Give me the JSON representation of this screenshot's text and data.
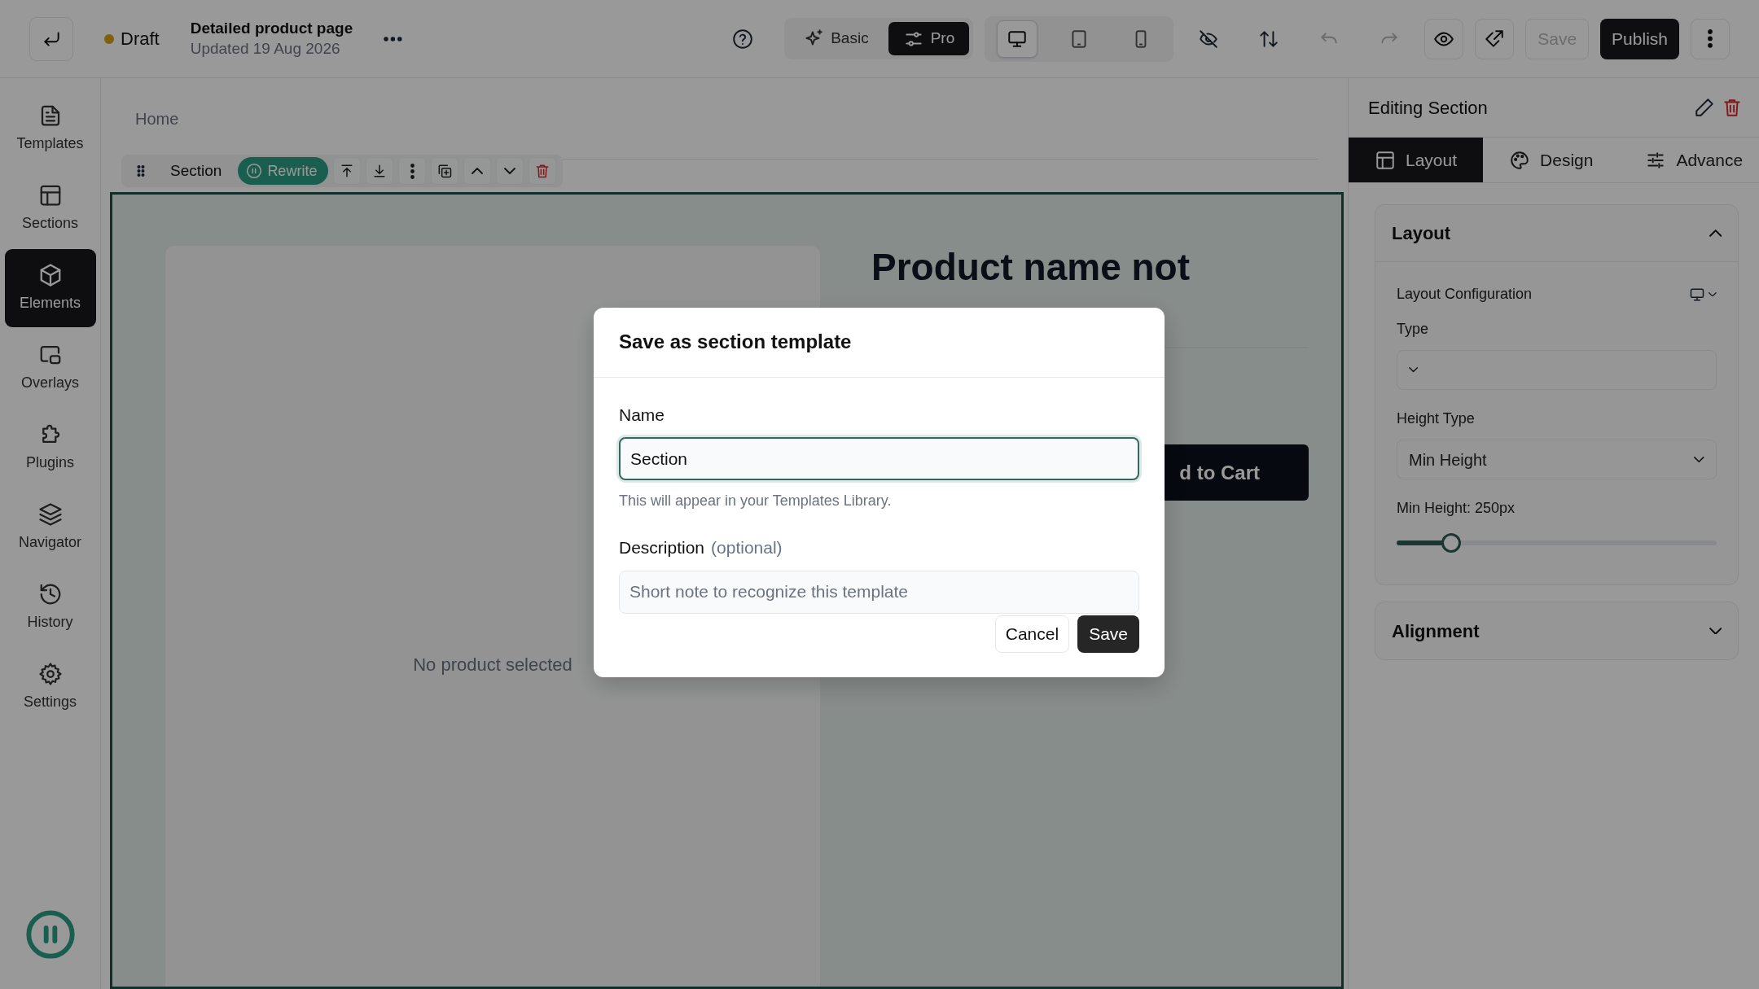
{
  "topbar": {
    "status": "Draft",
    "title": "Detailed product page",
    "updated": "Updated 19 Aug 2026",
    "modes": [
      {
        "kind": "basic",
        "label": "Basic",
        "selected": false
      },
      {
        "kind": "pro",
        "label": "Pro",
        "selected": true
      }
    ],
    "devices": [
      {
        "kind": "desktop",
        "selected": true
      },
      {
        "kind": "tablet",
        "selected": false
      },
      {
        "kind": "mobile",
        "selected": false
      }
    ],
    "history": [
      {
        "kind": "undo",
        "disabled": true
      },
      {
        "kind": "redo",
        "disabled": true
      }
    ],
    "save": {
      "label": "Save",
      "disabled": true
    },
    "publish": {
      "label": "Publish"
    }
  },
  "sidebar": {
    "items": [
      {
        "kind": "templates",
        "label": "Templates",
        "selected": false
      },
      {
        "kind": "sections",
        "label": "Sections",
        "selected": false
      },
      {
        "kind": "elements",
        "label": "Elements",
        "selected": true
      },
      {
        "kind": "overlays",
        "label": "Overlays",
        "selected": false
      },
      {
        "kind": "plugins",
        "label": "Plugins",
        "selected": false
      },
      {
        "kind": "navigator",
        "label": "Navigator",
        "selected": false
      },
      {
        "kind": "history",
        "label": "History",
        "selected": false
      },
      {
        "kind": "settings",
        "label": "Settings",
        "selected": false
      }
    ]
  },
  "canvas": {
    "breadcrumb": "Home",
    "toolbar": {
      "label": "Section",
      "rewrite": "Rewrite"
    },
    "product": {
      "empty_text": "No product selected",
      "heading": "Product name not",
      "button": "d to Cart"
    }
  },
  "panel": {
    "title": "Editing Section",
    "tabs": [
      {
        "kind": "layout",
        "label": "Layout",
        "selected": true
      },
      {
        "kind": "design",
        "label": "Design",
        "selected": false
      },
      {
        "kind": "advance",
        "label": "Advance",
        "selected": false
      }
    ],
    "groups": [
      {
        "title": "Layout",
        "expanded": true,
        "config_label": "Layout Configuration",
        "type_label": "Type",
        "height_type_label": "Height Type",
        "height_type_value": "Min Height",
        "min_height_label": "Min Height: 250px",
        "level": 0.17
      },
      {
        "title": "Alignment",
        "expanded": false
      }
    ]
  },
  "modal": {
    "title": "Save as section template",
    "name_label": "Name",
    "name_value": "Section",
    "name_help": "This will appear in your Templates Library.",
    "description_label": "Description",
    "description_note": "(optional)",
    "description_placeholder": "Short note to recognize this template",
    "cancel": "Cancel",
    "save": "Save"
  }
}
